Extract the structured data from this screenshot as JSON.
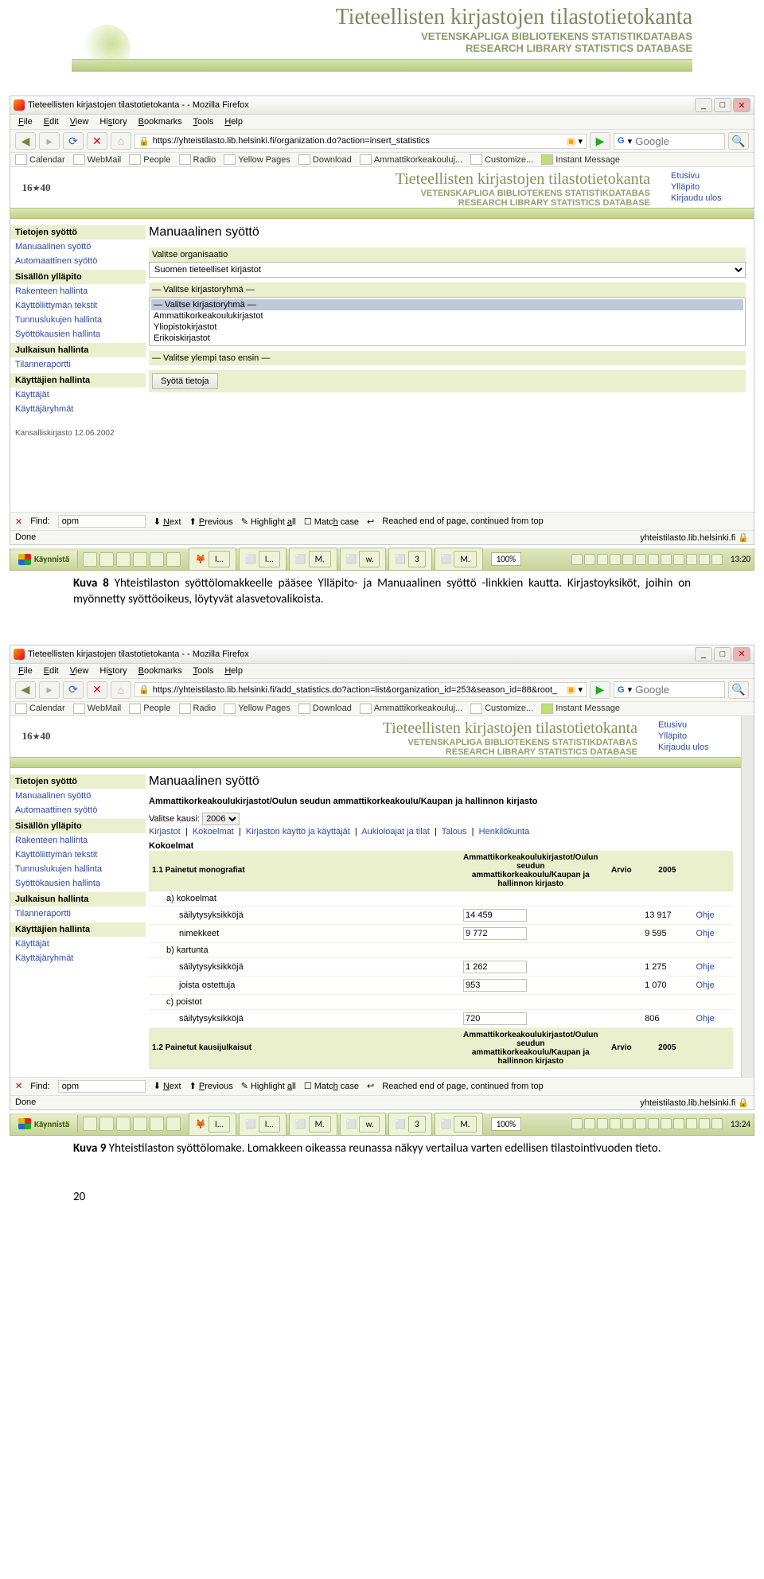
{
  "doc_header": {
    "title": "Tieteellisten kirjastojen tilastotietokanta",
    "sub1": "VETENSKAPLIGA BIBLIOTEKENS STATISTIKDATABAS",
    "sub2": "RESEARCH LIBRARY STATISTICS DATABASE"
  },
  "browser": {
    "window_title": "Tieteellisten kirjastojen tilastotietokanta - - Mozilla Firefox",
    "menus": [
      "File",
      "Edit",
      "View",
      "History",
      "Bookmarks",
      "Tools",
      "Help"
    ],
    "url1": "https://yhteistilasto.lib.helsinki.fi/organization.do?action=insert_statistics",
    "url2": "https://yhteistilasto.lib.helsinki.fi/add_statistics.do?action=list&organization_id=253&season_id=88&root_",
    "search_engine": "G",
    "search_placeholder": "Google",
    "bookmarks": [
      "Calendar",
      "WebMail",
      "People",
      "Radio",
      "Yellow Pages",
      "Download",
      "Ammattikorkeakouluj...",
      "Customize..."
    ],
    "instant_message": "Instant Message",
    "find_label": "Find:",
    "find_value": "opm",
    "find_buttons": {
      "next": "Next",
      "prev": "Previous",
      "hl": "Highlight all",
      "match": "Match case"
    },
    "find_status": "Reached end of page, continued from top",
    "status_done": "Done",
    "status_host": "yhteistilasto.lib.helsinki.fi"
  },
  "app": {
    "logo": {
      "top": "16",
      "sep": "★",
      "bot": "40"
    },
    "title": "Tieteellisten kirjastojen tilastotietokanta",
    "sub1": "VETENSKAPLIGA BIBLIOTEKENS STATISTIKDATABAS",
    "sub2": "RESEARCH LIBRARY STATISTICS DATABASE",
    "navlinks": [
      "Etusivu",
      "Ylläpito",
      "Kirjaudu ulos"
    ],
    "sidebar": [
      {
        "type": "grp",
        "label": "Tietojen syöttö"
      },
      {
        "type": "link",
        "label": "Manuaalinen syöttö"
      },
      {
        "type": "link",
        "label": "Automaattinen syöttö"
      },
      {
        "type": "grp",
        "label": "Sisällön ylläpito"
      },
      {
        "type": "link",
        "label": "Rakenteen hallinta"
      },
      {
        "type": "link",
        "label": "Käyttöliittymän tekstit"
      },
      {
        "type": "link",
        "label": "Tunnuslukujen hallinta"
      },
      {
        "type": "link",
        "label": "Syöttökausien hallinta"
      },
      {
        "type": "grp",
        "label": "Julkaisun hallinta"
      },
      {
        "type": "link",
        "label": "Tilanneraportti"
      },
      {
        "type": "grp",
        "label": "Käyttäjien hallinta"
      },
      {
        "type": "link",
        "label": "Käyttäjät"
      },
      {
        "type": "link",
        "label": "Käyttäjäryhmät"
      }
    ],
    "sidebar_footer": "Kansalliskirjasto 12.06.2002"
  },
  "shot1": {
    "heading": "Manuaalinen syöttö",
    "label_org": "Valitse organisaatio",
    "org_value": "Suomen tieteelliset kirjastot",
    "label_group": "— Valitse kirjastoryhmä —",
    "group_options": [
      "— Valitse kirjastoryhmä —",
      "Ammattikorkeakoulukirjastot",
      "Yliopistokirjastot",
      "Erikoiskirjastot"
    ],
    "label_upper": "— Valitse ylempi taso ensin —",
    "btn_submit": "Syötä tietoja"
  },
  "shot2": {
    "heading": "Manuaalinen syöttö",
    "breadcrumb": "Ammattikorkeakoulukirjastot/Oulun seudun ammattikorkeakoulu/Kaupan ja hallinnon kirjasto",
    "kausi_label": "Valitse kausi:",
    "kausi_value": "2006",
    "tabs": [
      "Kirjastot",
      "Kokoelmat",
      "Kirjaston käyttö ja käyttäjät",
      "Aukioloajat ja tilat",
      "Talous",
      "Henkilökunta"
    ],
    "section": "Kokoelmat",
    "th_center": "Ammattikorkeakoulukirjastot/Oulun seudun ammattikorkeakoulu/Kaupan ja hallinnon kirjasto",
    "th_arvio": "Arvio",
    "th_year": "2005",
    "ohje": "Ohje",
    "rows": [
      {
        "lvl": 0,
        "label": "1.1 Painetut monografiat",
        "val": "",
        "cmp": ""
      },
      {
        "lvl": 1,
        "label": "a) kokoelmat",
        "val": "",
        "cmp": ""
      },
      {
        "lvl": 2,
        "label": "säilytysyksikköjä",
        "val": "14 459",
        "cmp": "13 917"
      },
      {
        "lvl": 2,
        "label": "nimekkeet",
        "val": "9 772",
        "cmp": "9 595"
      },
      {
        "lvl": 1,
        "label": "b) kartunta",
        "val": "",
        "cmp": ""
      },
      {
        "lvl": 2,
        "label": "säilytysyksikköjä",
        "val": "1 262",
        "cmp": "1 275"
      },
      {
        "lvl": 2,
        "label": "joista ostettuja",
        "val": "953",
        "cmp": "1 070"
      },
      {
        "lvl": 1,
        "label": "c) poistot",
        "val": "",
        "cmp": ""
      },
      {
        "lvl": 2,
        "label": "säilytysyksikköjä",
        "val": "720",
        "cmp": "806"
      }
    ],
    "row2_label": "1.2 Painetut kausijulkaisut",
    "th2_center": "Ammattikorkeakoulukirjastot/Oulun seudun ammattikorkeakoulu/Kaupan ja hallinnon kirjasto"
  },
  "taskbar": {
    "start": "Käynnistä",
    "running": [
      "I...",
      "I...",
      "M.",
      "w.",
      "3 ",
      "M."
    ],
    "zoom": "100%",
    "clock1": "13:20",
    "clock2": "13:24"
  },
  "captions": {
    "c8": "Kuva 8 Yhteistilaston syöttölomakkeelle pääsee Ylläpito- ja Manuaalinen syöttö -linkkien kautta. Kirjastoyksiköt, joihin on myönnetty syöttöoikeus, löytyvät alasvetovalikoista.",
    "c9": "Kuva 9 Yhteistilaston syöttölomake. Lomakkeen oikeassa reunassa näkyy vertailua varten edellisen tilastointivuoden tieto.",
    "pagenum": "20"
  }
}
